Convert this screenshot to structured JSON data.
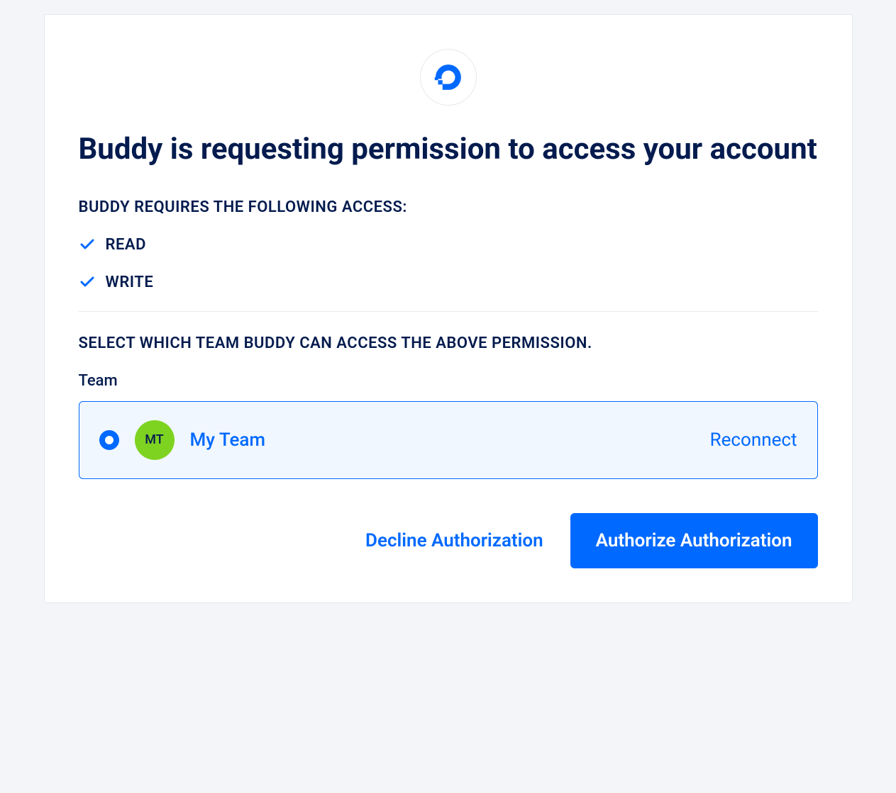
{
  "title": "Buddy is requesting permission to access your account",
  "access_heading": "BUDDY REQUIRES THE FOLLOWING ACCESS:",
  "permissions": [
    {
      "label": "READ"
    },
    {
      "label": "WRITE"
    }
  ],
  "team_select_heading": "SELECT WHICH TEAM BUDDY CAN ACCESS THE ABOVE PERMISSION.",
  "team_label": "Team",
  "team": {
    "avatar_initials": "MT",
    "name": "My Team",
    "reconnect_label": "Reconnect",
    "selected": true
  },
  "actions": {
    "decline_label": "Decline Authorization",
    "authorize_label": "Authorize Authorization"
  },
  "colors": {
    "primary": "#0069ff",
    "dark": "#031b4e",
    "avatar": "#7ed321",
    "panel_bg": "#f1f7ff"
  }
}
